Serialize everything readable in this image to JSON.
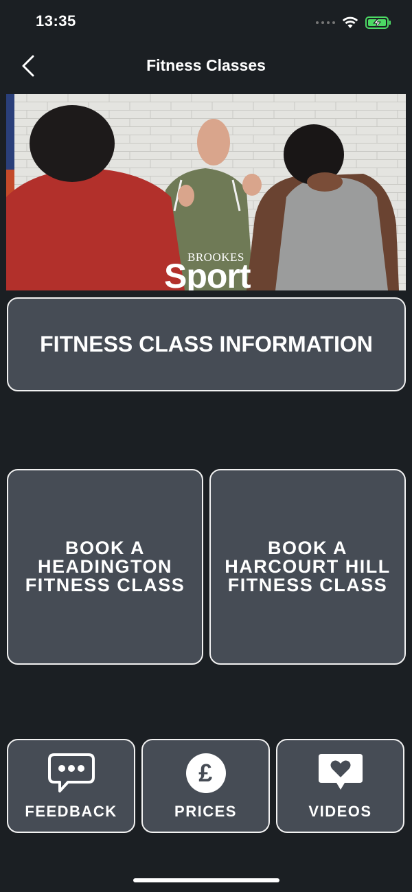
{
  "status_bar": {
    "time": "13:35"
  },
  "nav": {
    "title": "Fitness Classes"
  },
  "hero": {
    "logo_small": "BROOKES",
    "logo_big": "Sport"
  },
  "tiles": {
    "info": "FITNESS CLASS INFORMATION",
    "headington": [
      "BOOK A",
      "HEADINGTON",
      "FITNESS CLASS"
    ],
    "harcourt": [
      "BOOK A",
      "HARCOURT HILL",
      "FITNESS CLASS"
    ],
    "feedback": "FEEDBACK",
    "prices": "PRICES",
    "videos": "VIDEOS"
  },
  "icons": {
    "back": "chevron-left-icon",
    "feedback": "chat-bubble-icon",
    "prices": "pound-icon",
    "videos": "heart-bubble-icon"
  },
  "colors": {
    "background": "#1b1f23",
    "tile": "#464c55",
    "tile_border": "#f2f2f2",
    "battery": "#4cd964"
  }
}
